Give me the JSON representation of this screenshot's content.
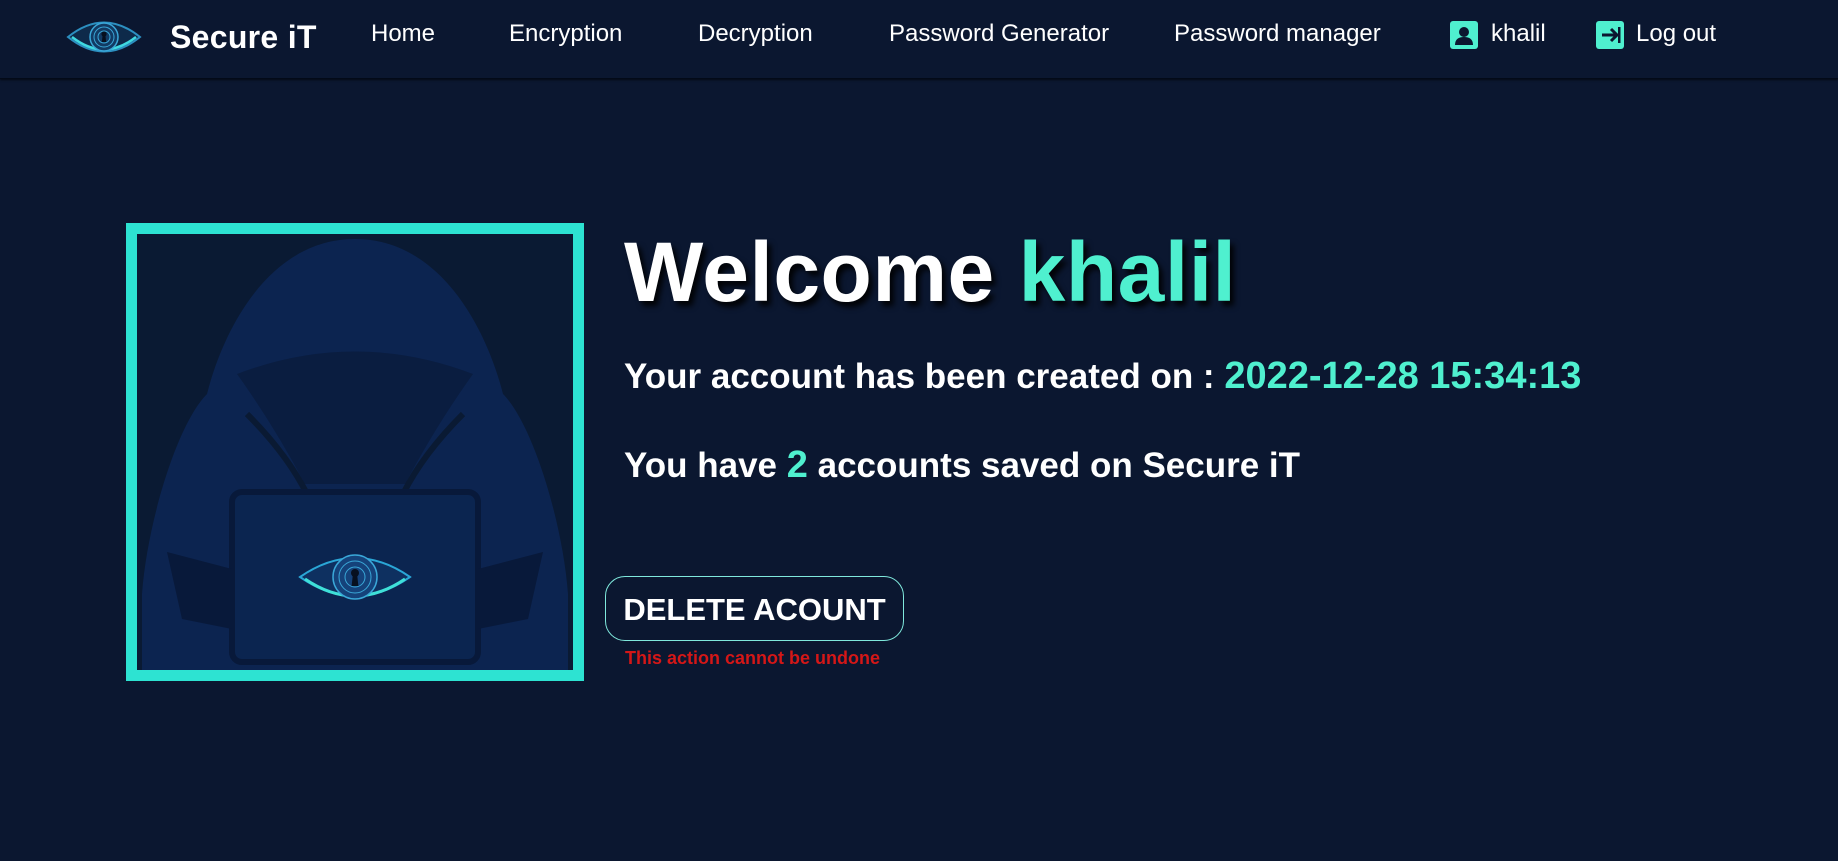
{
  "nav": {
    "brand_name": "Secure iT",
    "links": [
      {
        "label": "Home"
      },
      {
        "label": "Encryption"
      },
      {
        "label": "Decryption"
      },
      {
        "label": "Password Generator"
      },
      {
        "label": "Password manager"
      }
    ],
    "username": "khalil",
    "logout_label": "Log out"
  },
  "main": {
    "welcome_word": "Welcome",
    "welcome_name": "khalil",
    "created_prefix": "Your account has been created on :",
    "created_date": "2022-12-28 15:34:13",
    "accounts_prefix": "You have",
    "accounts_count": "2",
    "accounts_suffix": "accounts saved on Secure iT",
    "delete_label": "DELETE ACOUNT",
    "warning_text": "This action cannot be undone"
  },
  "colors": {
    "background": "#0b1730",
    "accent": "#4ff0cf",
    "frame": "#2de3d2",
    "warning": "#d41717"
  },
  "icons": {
    "brand": "eye-keyhole-logo",
    "user": "user-badge-icon",
    "logout": "logout-arrow-icon",
    "avatar": "hooded-hacker-avatar"
  }
}
